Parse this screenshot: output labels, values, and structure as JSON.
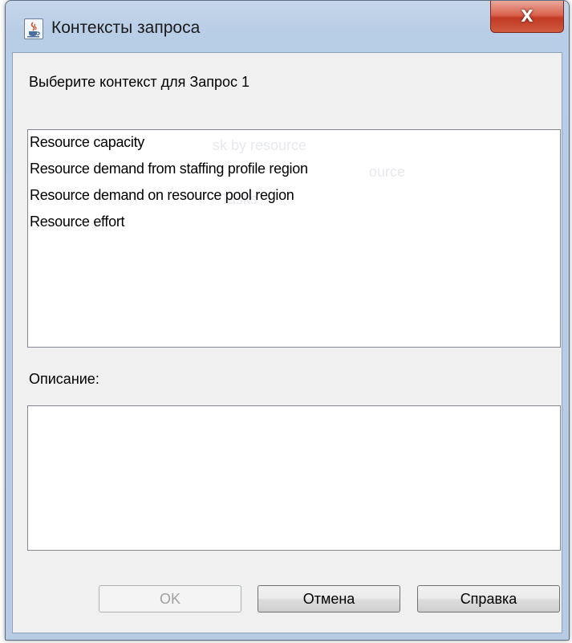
{
  "window": {
    "title": "Контексты запроса",
    "close_glyph": "X",
    "app_icon": "java-cup-icon"
  },
  "prompt": "Выберите контекст для Запрос 1",
  "context_list": {
    "items": [
      "Resource capacity",
      "Resource demand from staffing profile region",
      "Resource demand on resource pool region",
      "Resource effort"
    ],
    "ghost_text": [
      "sk by resource",
      "ource",
      "Tasks"
    ]
  },
  "description": {
    "label": "Описание:",
    "value": ""
  },
  "buttons": {
    "ok": "OK",
    "cancel": "Отмена",
    "help": "Справка"
  },
  "colors": {
    "frame": "#b8cde6",
    "close_button": "#c23a23",
    "client_bg": "#f0f0f0"
  }
}
